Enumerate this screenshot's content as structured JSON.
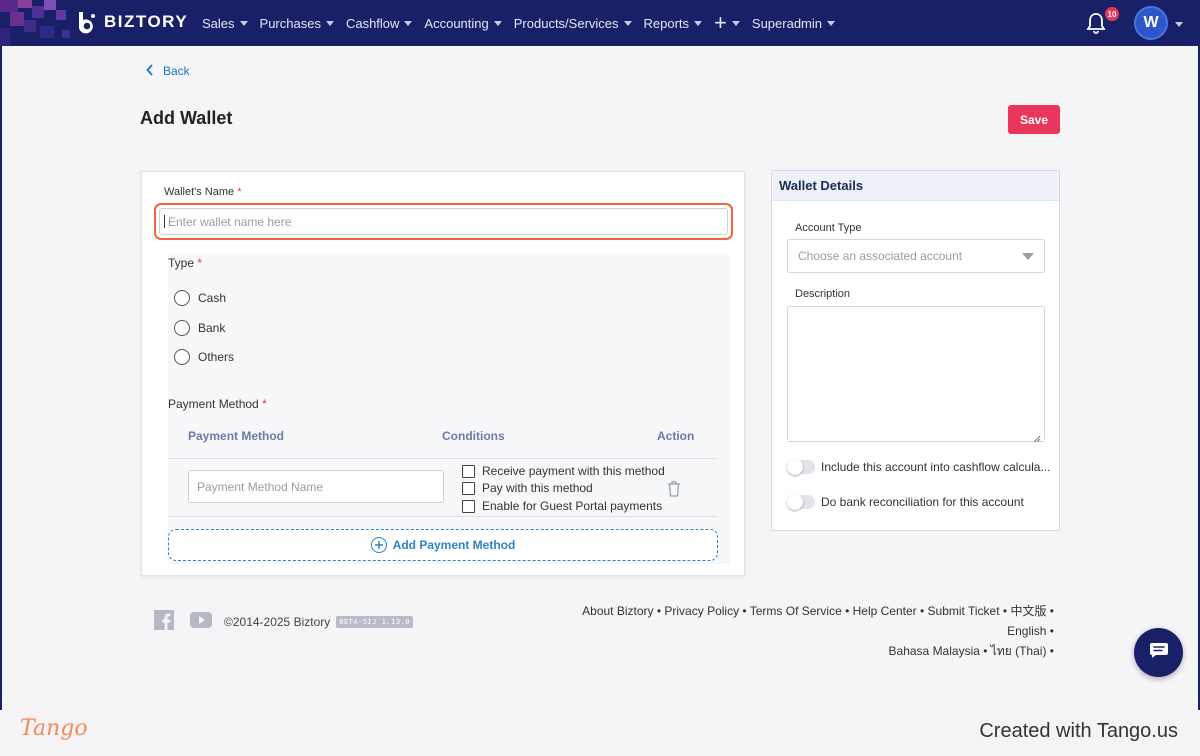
{
  "nav": {
    "brand": "BIZTORY",
    "menu": [
      {
        "label": "Sales"
      },
      {
        "label": "Purchases"
      },
      {
        "label": "Cashflow"
      },
      {
        "label": "Accounting"
      },
      {
        "label": "Products/Services"
      },
      {
        "label": "Reports"
      },
      {
        "label": "+"
      },
      {
        "label": "Superadmin"
      }
    ],
    "notification_count": "10",
    "avatar_initial": "W"
  },
  "page": {
    "back_label": "Back",
    "title": "Add Wallet",
    "save_label": "Save"
  },
  "form": {
    "wallet_name_label": "Wallet's Name",
    "required_mark": "*",
    "wallet_name_placeholder": "Enter wallet name here",
    "wallet_name_value": "",
    "type_label": "Type",
    "type_options": [
      "Cash",
      "Bank",
      "Others"
    ],
    "payment_method_label": "Payment Method",
    "table_headers": {
      "payment_method": "Payment Method",
      "conditions": "Conditions",
      "action": "Action"
    },
    "payment_method_name_placeholder": "Payment Method Name",
    "conditions": [
      {
        "label": "Receive payment with this method",
        "checked": false
      },
      {
        "label": "Pay with this method",
        "checked": false
      },
      {
        "label": "Enable for Guest Portal payments",
        "checked": false
      }
    ],
    "add_payment_method_label": "Add Payment Method"
  },
  "wallet_details": {
    "title": "Wallet Details",
    "account_type_label": "Account Type",
    "account_type_placeholder": "Choose an associated account",
    "description_label": "Description",
    "toggles": [
      {
        "label": "Include this account into cashflow calcula...",
        "on": false
      },
      {
        "label": "Do bank reconciliation for this account",
        "on": false
      }
    ]
  },
  "footer": {
    "copyright": "©2014-2025 Biztory",
    "version": "BETA-SIJ 1.13.0",
    "links": [
      "About Biztory",
      "Privacy Policy",
      "Terms Of Service",
      "Help Center",
      "Submit Ticket",
      "中文版",
      "English",
      "Bahasa Malaysia",
      "ไทย (Thai)"
    ]
  },
  "tango": {
    "logo": "Tango",
    "credit": "Created with Tango.us"
  },
  "colors": {
    "nav_bg": "#1a2068",
    "accent_red": "#e8365d",
    "link_blue": "#1e78c2",
    "highlight_orange": "#f0643a"
  },
  "icons": [
    "bell-icon",
    "chevron-left-icon",
    "trash-icon",
    "plus-circle-icon",
    "facebook-icon",
    "youtube-icon",
    "chat-icon"
  ]
}
